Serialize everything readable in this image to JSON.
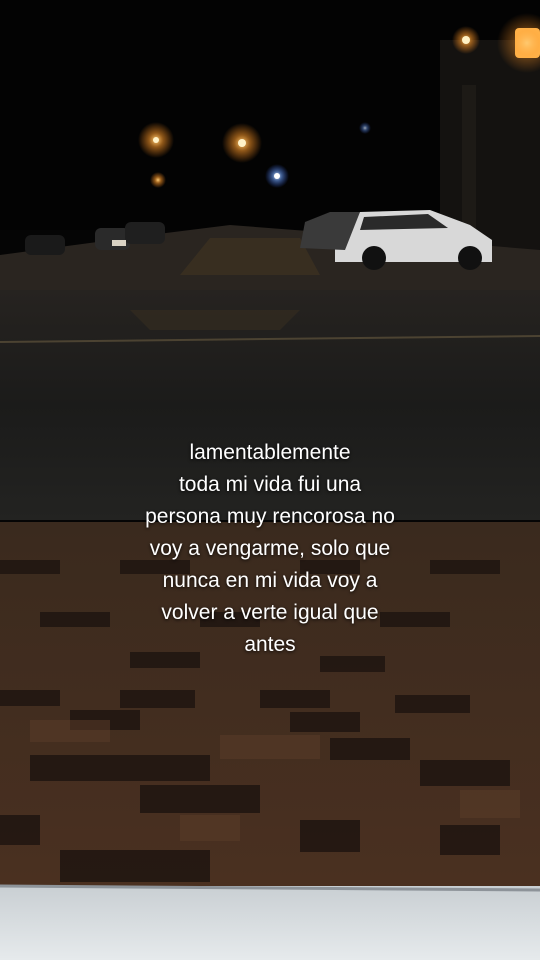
{
  "caption": {
    "lines": [
      "lamentablemente",
      "toda mi vida fui una",
      "persona muy rencorosa no",
      "voy a vengarme, solo que",
      "nunca en mi vida voy a",
      "volver a verte igual que",
      "antes"
    ]
  },
  "scene": {
    "description_icons": [
      "street-lamp-icon",
      "parked-car-icon"
    ],
    "colors": {
      "sky": "#030303",
      "asphalt": "#1e1e1c",
      "brick_dark": "#2a1c12",
      "brick_light": "#4b3222",
      "curb": "#d8dde0",
      "lamp": "#ffb14a",
      "blue_light": "#7fb0ff"
    }
  }
}
